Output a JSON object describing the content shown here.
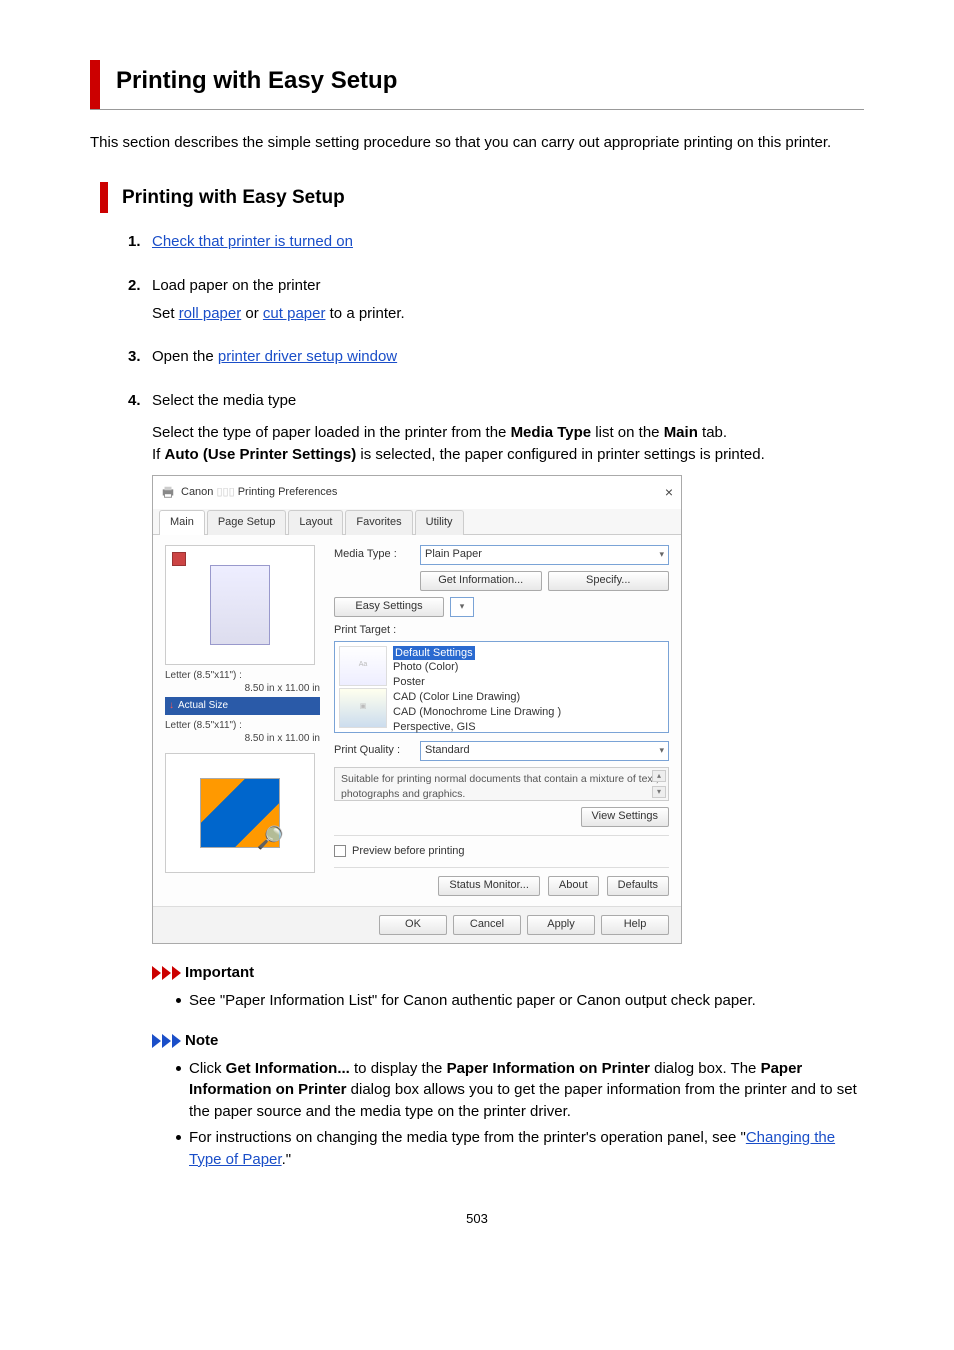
{
  "h1": "Printing with Easy Setup",
  "intro": "This section describes the simple setting procedure so that you can carry out appropriate printing on this printer.",
  "h2": "Printing with Easy Setup",
  "steps": {
    "s1": {
      "num": "1.",
      "link": "Check that printer is turned on"
    },
    "s2": {
      "num": "2.",
      "title": "Load paper on the printer",
      "pre": "Set ",
      "link1": "roll paper",
      "mid": " or ",
      "link2": "cut paper",
      "post": " to a printer."
    },
    "s3": {
      "num": "3.",
      "pre": "Open the ",
      "link": "printer driver setup window"
    },
    "s4": {
      "num": "4.",
      "title": "Select the media type",
      "line1_a": "Select the type of paper loaded in the printer from the ",
      "line1_b": "Media Type",
      "line1_c": " list on the ",
      "line1_d": "Main",
      "line1_e": " tab.",
      "line2_a": "If ",
      "line2_b": "Auto (Use Printer Settings)",
      "line2_c": " is selected, the paper configured in printer settings is printed."
    }
  },
  "dlg": {
    "title_brand": "Canon",
    "title_rest": "Printing Preferences",
    "close": "×",
    "tabs": [
      "Main",
      "Page Setup",
      "Layout",
      "Favorites",
      "Utility"
    ],
    "left": {
      "size1_a": "Letter (8.5\"x11\") :",
      "size1_b": "8.50 in x 11.00 in",
      "actual": "Actual Size",
      "size2_a": "Letter (8.5\"x11\") :",
      "size2_b": "8.50 in x 11.00 in"
    },
    "right": {
      "media_lbl": "Media Type :",
      "media_val": "Plain Paper",
      "get_info": "Get Information...",
      "specify": "Specify...",
      "easy_lbl": "Easy Settings",
      "target_lbl": "Print Target :",
      "opts": {
        "sel": "Default Settings",
        "o1": "Photo (Color)",
        "o2": "Poster",
        "o3": "CAD (Color Line Drawing)",
        "o4": "CAD (Monochrome Line Drawing )",
        "o5": "Perspective, GIS"
      },
      "quality_lbl": "Print Quality :",
      "quality_val": "Standard",
      "desc": "Suitable for printing normal documents that contain a mixture of text, photographs and graphics.",
      "view": "View Settings",
      "preview_chk": "Preview before printing",
      "status": "Status Monitor...",
      "about": "About",
      "defaults": "Defaults"
    },
    "footer": {
      "ok": "OK",
      "cancel": "Cancel",
      "apply": "Apply",
      "help": "Help"
    }
  },
  "important": {
    "label": "Important",
    "b1": "See \"Paper Information List\" for Canon authentic paper or Canon output check paper."
  },
  "note": {
    "label": "Note",
    "b1_a": "Click ",
    "b1_b": "Get Information...",
    "b1_c": " to display the ",
    "b1_d": "Paper Information on Printer",
    "b1_e": " dialog box. The ",
    "b1_f": "Paper Information on Printer",
    "b1_g": " dialog box allows you to get the paper information from the printer and to set the paper source and the media type on the printer driver.",
    "b2_a": "For instructions on changing the media type from the printer's operation panel, see \"",
    "b2_link": "Changing the Type of Paper",
    "b2_b": ".\""
  },
  "pagenum": "503"
}
